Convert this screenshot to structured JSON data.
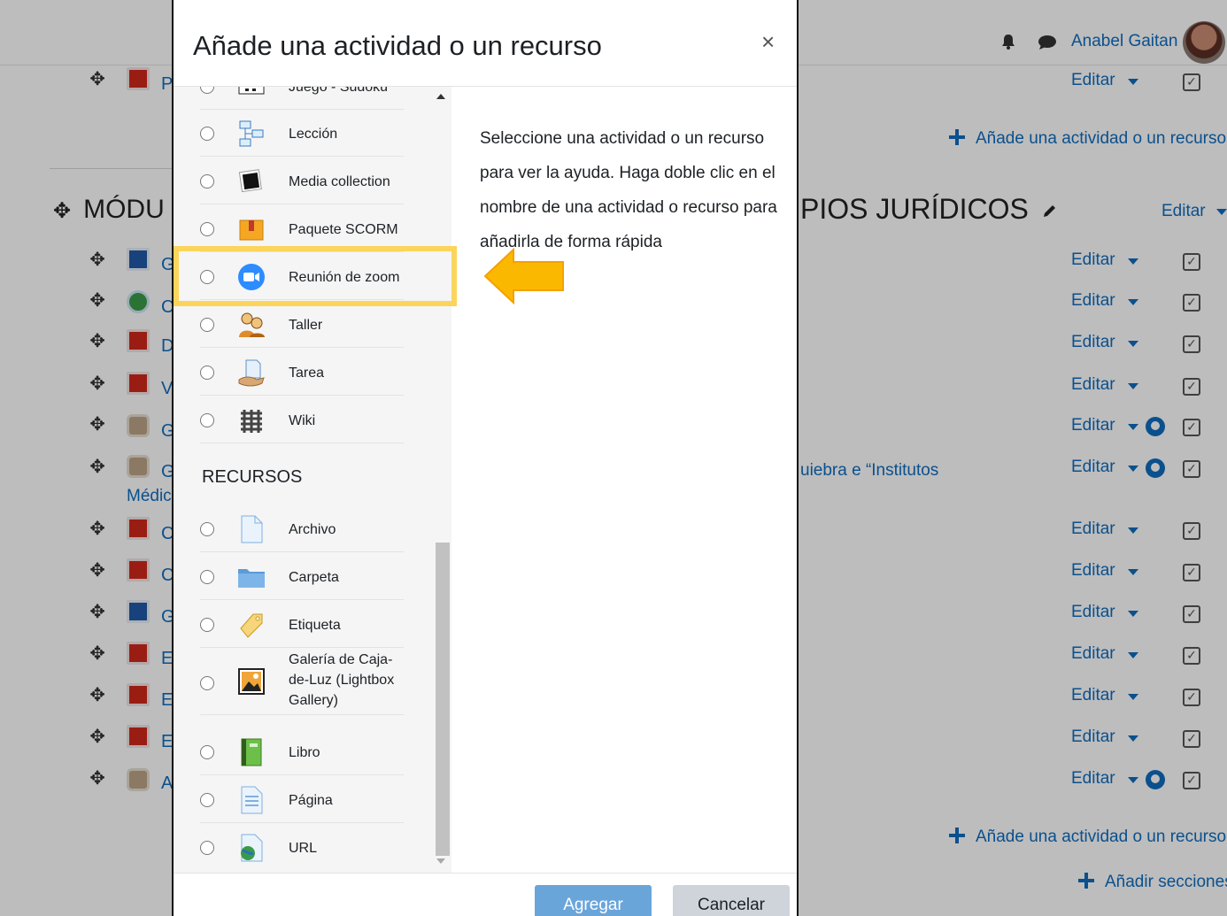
{
  "header": {
    "user_name": "Anabel Gaitan",
    "icons": [
      "bell-icon",
      "chat-icon",
      "avatar"
    ]
  },
  "background": {
    "section_title_left": "MÓDU",
    "section_title_right": "PIOS JURÍDICOS",
    "peek_letters": [
      "P",
      "G",
      "C",
      "D",
      "V",
      "G",
      "G",
      "C",
      "C",
      "G",
      "E",
      "E",
      "E",
      "A"
    ],
    "medic_text": "Médic",
    "row_text_partial": "uiebra e “Institutos",
    "edit_label": "Editar",
    "add_activity_label": "Añade una actividad o un recurso",
    "add_sections_label": "Añadir secciones"
  },
  "modal": {
    "title": "Añade una actividad o un recurso",
    "close_symbol": "×",
    "activities": [
      {
        "label": "Juego - Sudoku",
        "icon": "sudoku-icon"
      },
      {
        "label": "Lección",
        "icon": "lesson-icon"
      },
      {
        "label": "Media collection",
        "icon": "media-collection-icon"
      },
      {
        "label": "Paquete SCORM",
        "icon": "scorm-package-icon"
      },
      {
        "label": "Reunión de zoom",
        "icon": "zoom-icon"
      },
      {
        "label": "Taller",
        "icon": "workshop-icon"
      },
      {
        "label": "Tarea",
        "icon": "assignment-icon"
      },
      {
        "label": "Wiki",
        "icon": "wiki-icon"
      }
    ],
    "resources_heading": "RECURSOS",
    "resources": [
      {
        "label": "Archivo",
        "icon": "file-icon"
      },
      {
        "label": "Carpeta",
        "icon": "folder-icon"
      },
      {
        "label": "Etiqueta",
        "icon": "label-tag-icon"
      },
      {
        "label": "Galería de Caja-de-Luz (Lightbox Gallery)",
        "icon": "gallery-icon"
      },
      {
        "label": "Libro",
        "icon": "book-icon"
      },
      {
        "label": "Página",
        "icon": "page-icon"
      },
      {
        "label": "URL",
        "icon": "url-icon"
      }
    ],
    "help_text": "Seleccione una actividad o un recurso para ver la ayuda. Haga doble clic en el nombre de una actividad o recurso para añadirla de forma rápida",
    "add_button": "Agregar",
    "cancel_button": "Cancelar"
  },
  "annotation": {
    "highlight_color": "#fbd55b",
    "arrow_color": "#fbb800",
    "highlighted_item": "Reunión de zoom"
  },
  "colors": {
    "link": "#0f6cbf",
    "primary_button": "#6aa5da",
    "secondary_button": "#ced4da",
    "list_background": "#f5f5f5"
  }
}
